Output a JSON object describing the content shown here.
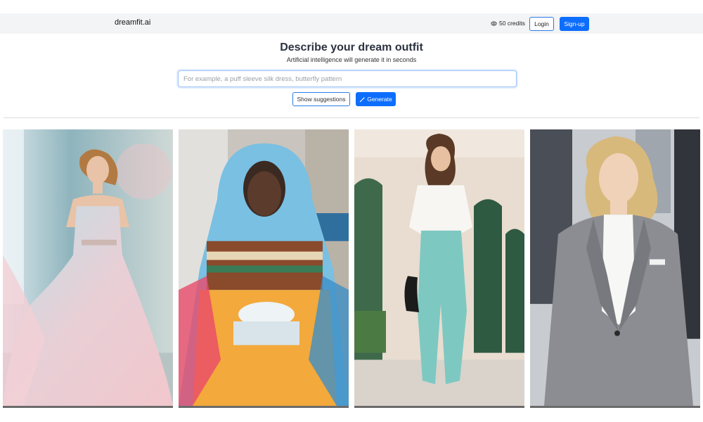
{
  "header": {
    "brand": "dreamfit.ai",
    "credits_icon": "coin-icon",
    "credits": "50 credits",
    "login_label": "Login",
    "signup_label": "Sign-up"
  },
  "hero": {
    "title": "Describe your dream outfit",
    "subtitle": "Artificial intelligence will generate it in seconds",
    "input_placeholder": "For example, a puff sleeve silk dress, butterfly pattern",
    "input_value": "",
    "suggest_label": "Show suggestions",
    "generate_icon": "magic-wand-icon",
    "generate_label": "Generate"
  },
  "gallery": {
    "items": [
      {
        "subject": "flowing pastel gown",
        "colors": [
          "#e7c6cc",
          "#a9d3dc"
        ]
      },
      {
        "subject": "graphic oversized hoodie",
        "colors": [
          "#6fb9df",
          "#f1a73b"
        ]
      },
      {
        "subject": "white blouse and teal trousers",
        "colors": [
          "#ffffff",
          "#7ec8c2"
        ]
      },
      {
        "subject": "grey tailored blazer",
        "colors": [
          "#8b8d92",
          "#ffffff"
        ]
      }
    ]
  }
}
